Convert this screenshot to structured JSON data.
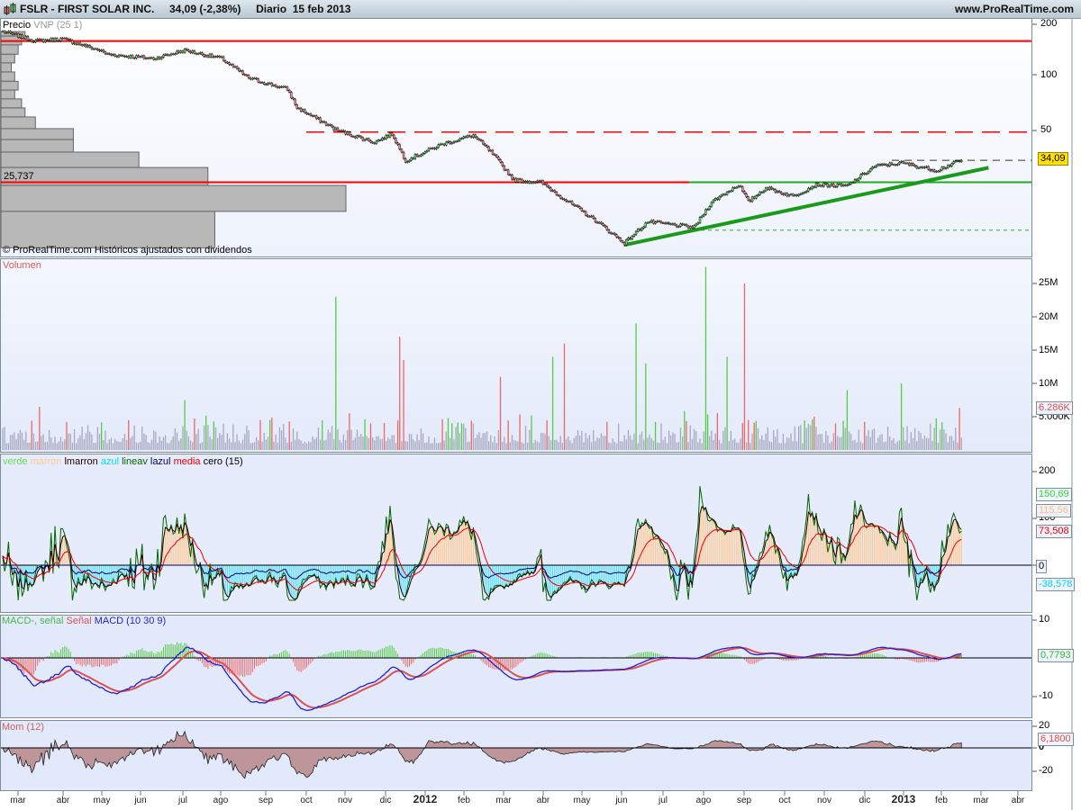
{
  "header": {
    "symbol": "FSLR - FIRST SOLAR INC.",
    "price": "34,09 (-2,38%)",
    "period": "Diario",
    "date": "15 feb 2013",
    "site": "www.ProRealTime.com"
  },
  "price_panel": {
    "legend_a": "Precio",
    "legend_b": "VNP (25 1)",
    "footer": "© ProRealTime.com  Históricos ajustados con dividendos",
    "level_label": "25,737",
    "last_tag": "34,09",
    "axis": [
      "200",
      "100",
      "50"
    ]
  },
  "volume_panel": {
    "legend": "Volumen",
    "axis": [
      "25M",
      "20M",
      "15M",
      "10M",
      "5.000K"
    ],
    "last_tag": "6.286K"
  },
  "ind_panel": {
    "legend": [
      {
        "t": "verde",
        "c": "#66dd55"
      },
      {
        "t": "marron",
        "c": "#ffc890"
      },
      {
        "t": "lmarron",
        "c": "#220000"
      },
      {
        "t": "azul",
        "c": "#00e0ff"
      },
      {
        "t": "lineav",
        "c": "#006600"
      },
      {
        "t": "lazul",
        "c": "#000066"
      },
      {
        "t": "media",
        "c": "#ee0000"
      },
      {
        "t": "cero (15)",
        "c": "#000"
      }
    ],
    "axis": [
      "200",
      "100",
      "0"
    ],
    "tags": [
      {
        "t": "150,69",
        "c": "#33dd33"
      },
      {
        "t": "115,56",
        "c": "#ffbb88"
      },
      {
        "t": "73,508",
        "c": "#ee0000"
      },
      {
        "t": "0",
        "c": "#000"
      },
      {
        "t": "-38,578",
        "c": "#00d8ff"
      }
    ]
  },
  "macd_panel": {
    "legend": [
      {
        "t": "MACD-, señal",
        "c": "#44bb44"
      },
      {
        "t": "Señal",
        "c": "#e05050"
      },
      {
        "t": "MACD (10 30 9)",
        "c": "#2222cc"
      }
    ],
    "axis": [
      "10",
      "-10"
    ],
    "last_tag": "0,7793"
  },
  "mom_panel": {
    "legend": "Mom (12)",
    "axis": [
      "20",
      "0",
      "-20"
    ],
    "last_tag": "6,1800"
  },
  "x_axis": {
    "months": [
      "mar",
      "abr",
      "may",
      "jun",
      "jul",
      "ago",
      "sep",
      "oct",
      "nov",
      "dic",
      "2012",
      "feb",
      "mar",
      "abr",
      "may",
      "jun",
      "jul",
      "ago",
      "sep",
      "oct",
      "nov",
      "dic",
      "2013",
      "feb",
      "mar",
      "abr"
    ]
  },
  "chart_data": {
    "type": "line",
    "bars": 496,
    "price_keypoints": [
      [
        0,
        178
      ],
      [
        17,
        158
      ],
      [
        31,
        162
      ],
      [
        50,
        140
      ],
      [
        54,
        133
      ],
      [
        78,
        126
      ],
      [
        94,
        140
      ],
      [
        113,
        126
      ],
      [
        127,
        98
      ],
      [
        147,
        85
      ],
      [
        152,
        67
      ],
      [
        173,
        50
      ],
      [
        192,
        43
      ],
      [
        201,
        48
      ],
      [
        208,
        34
      ],
      [
        227,
        42
      ],
      [
        243,
        47
      ],
      [
        252,
        38
      ],
      [
        264,
        26.5
      ],
      [
        278,
        25.7
      ],
      [
        292,
        20
      ],
      [
        306,
        15.8
      ],
      [
        321,
        11.8
      ],
      [
        333,
        15.5
      ],
      [
        357,
        14.4
      ],
      [
        366,
        20
      ],
      [
        380,
        25
      ],
      [
        385,
        20
      ],
      [
        394,
        24
      ],
      [
        408,
        21.5
      ],
      [
        420,
        25
      ],
      [
        436,
        24.5
      ],
      [
        450,
        31.5
      ],
      [
        464,
        33
      ],
      [
        482,
        30
      ],
      [
        495,
        34.09
      ]
    ],
    "price_scale": "log",
    "price_range": [
      10,
      200
    ],
    "levels": [
      {
        "price": 157.7,
        "style": "solid",
        "color": "#ff0000"
      },
      {
        "price": 49,
        "style": "dashed",
        "color": "#ff0000"
      },
      {
        "price": 25.737,
        "style": "solid",
        "color": "#ff0000"
      },
      {
        "price": 25.737,
        "style": "solid",
        "color": "#22aa22"
      },
      {
        "price": 34.09,
        "style": "dashed",
        "color": "#333333"
      },
      {
        "price": 13.9,
        "style": "dashed",
        "color": "#22bb22"
      }
    ],
    "trendline": {
      "from": [
        321,
        11.5
      ],
      "to": [
        509,
        31
      ]
    },
    "vnp": [
      [
        168,
        178,
        7
      ],
      [
        150,
        168,
        6
      ],
      [
        133,
        150,
        5
      ],
      [
        119,
        133,
        4
      ],
      [
        106,
        119,
        3
      ],
      [
        94,
        106,
        4
      ],
      [
        84,
        94,
        5
      ],
      [
        75,
        84,
        4
      ],
      [
        66.8,
        75,
        6
      ],
      [
        59.5,
        66.8,
        7
      ],
      [
        51.2,
        59.5,
        10
      ],
      [
        44.5,
        51.2,
        21
      ],
      [
        37.9,
        44.5,
        21
      ],
      [
        31.1,
        37.9,
        40
      ],
      [
        24.7,
        31.1,
        60
      ],
      [
        17.7,
        24.7,
        100
      ],
      [
        11.1,
        17.7,
        62
      ]
    ],
    "volume_spikes_M": [
      [
        19,
        6.5
      ],
      [
        94,
        7.5
      ],
      [
        172,
        23
      ],
      [
        205,
        17
      ],
      [
        207,
        13.5
      ],
      [
        257,
        11
      ],
      [
        284,
        14
      ],
      [
        290,
        16
      ],
      [
        327,
        19
      ],
      [
        332,
        13
      ],
      [
        363,
        27.5
      ],
      [
        374,
        14
      ],
      [
        383,
        25
      ],
      [
        436,
        9
      ],
      [
        464,
        10
      ],
      [
        494,
        6.3
      ]
    ],
    "volume_range_M": [
      0,
      28
    ],
    "oscillator_range": [
      -80,
      230
    ],
    "macd_range": [
      -15,
      12
    ],
    "mom_range": [
      -35,
      25
    ]
  }
}
